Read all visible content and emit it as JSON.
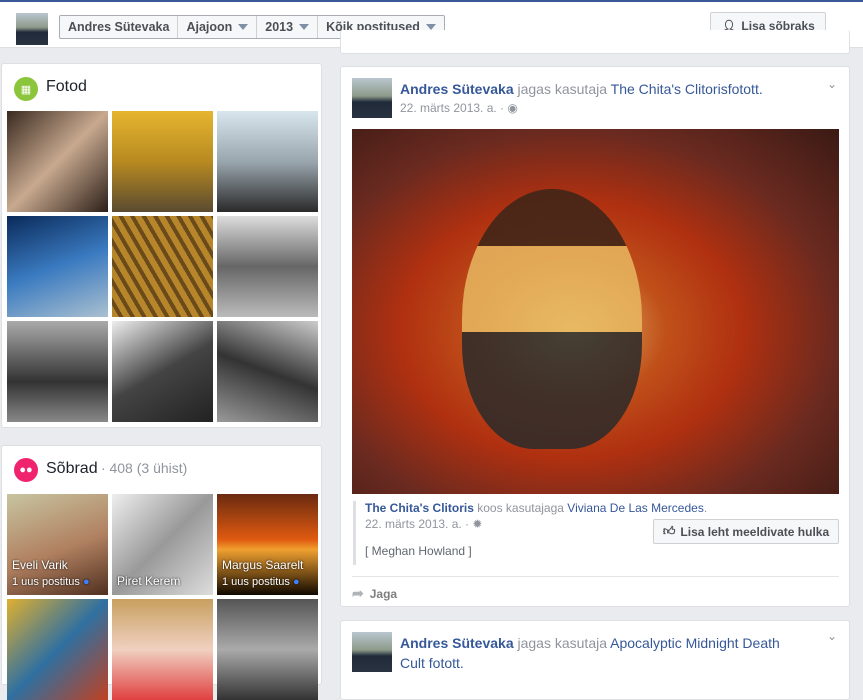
{
  "topbar": {
    "profile_name": "Andres Sütevaka",
    "timeline": "Ajajoon",
    "year": "2013",
    "filter": "Kõik postitused",
    "add_friend": "Lisa sõbraks"
  },
  "photos": {
    "title": "Fotod",
    "icon": "photo-icon",
    "color": "#8ac53b"
  },
  "friends": {
    "title": "Sõbrad",
    "count": "· 408 (3 ühist)",
    "color": "#f0236f",
    "items": [
      {
        "name": "Eveli Varik",
        "sub": "1 uus postitus"
      },
      {
        "name": "Piret Kerem",
        "sub": ""
      },
      {
        "name": "Margus Saarelt",
        "sub": "1 uus postitus"
      }
    ]
  },
  "post1": {
    "author": "Andres Sütevaka",
    "verb": "jagas kasutaja",
    "target": "The Chita's Clitoris",
    "suffix": "fotott.",
    "date": "22. märts 2013. a. ·",
    "caption": {
      "page": "The Chita's Clitoris",
      "with": "koos kasutajaga",
      "person": "Viviana De Las Mercedes",
      "end": ".",
      "date": "22. märts 2013. a. ·",
      "credit": "[ Meghan Howland ]"
    },
    "like_page": "Lisa leht meeldivate hulka",
    "share": "Jaga"
  },
  "post2": {
    "author": "Andres Sütevaka",
    "verb": "jagas kasutaja",
    "target": "Apocalyptic Midnight Death Cult",
    "suffix": "fotott."
  }
}
